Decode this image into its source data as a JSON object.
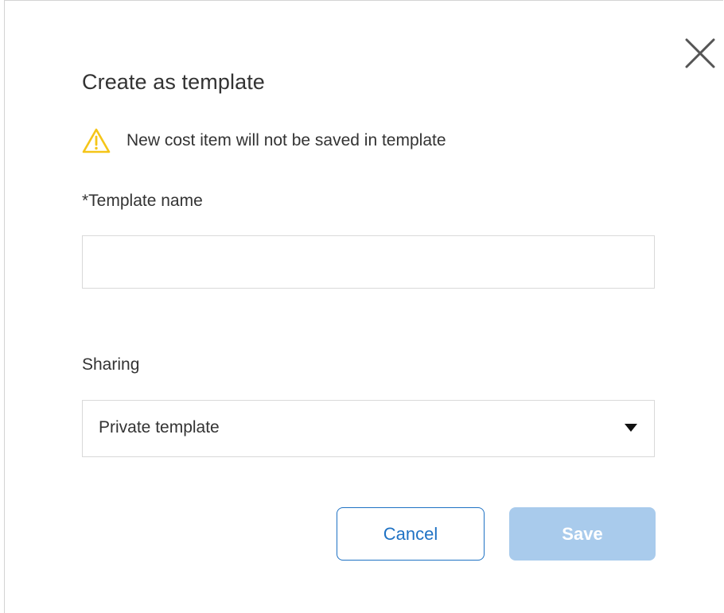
{
  "dialog": {
    "title": "Create as template",
    "warning": {
      "icon": "warning-triangle-icon",
      "color": "#f5c518",
      "text": "New cost item will not be saved in template"
    },
    "close_icon": "close-icon",
    "template_name": {
      "label": "*Template name",
      "value": "",
      "placeholder": ""
    },
    "sharing": {
      "label": "Sharing",
      "selected": "Private template",
      "arrow_icon": "caret-down-icon"
    },
    "buttons": {
      "cancel_label": "Cancel",
      "save_label": "Save"
    },
    "colors": {
      "primary": "#1f72c4",
      "save_disabled_bg": "#a9cbec",
      "text": "#333333",
      "border": "#d9d9d9"
    }
  }
}
